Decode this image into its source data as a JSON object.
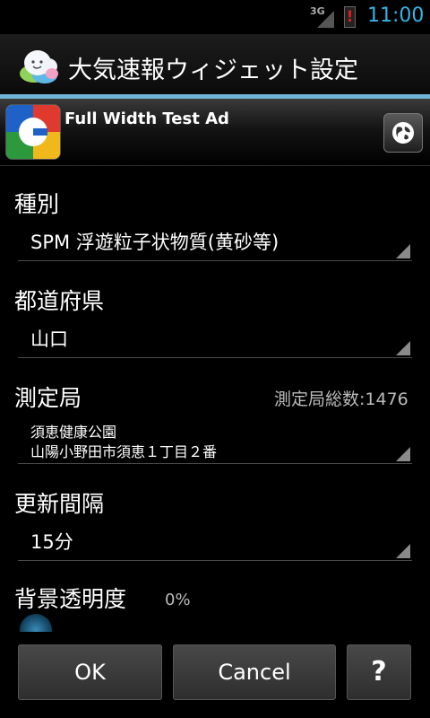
{
  "statusbar": {
    "network": "3G",
    "time": "11:00",
    "battery_warning": "!"
  },
  "header": {
    "title": "大気速報ウィジェット設定"
  },
  "ad": {
    "text": "Full Width Test Ad"
  },
  "settings": {
    "type": {
      "label": "種別",
      "value": "SPM 浮遊粒子状物質(黄砂等)"
    },
    "prefecture": {
      "label": "都道府県",
      "value": "山口"
    },
    "station": {
      "label": "測定局",
      "count_label": "測定局総数:1476",
      "name": "須恵健康公園",
      "address": "山陽小野田市須恵１丁目２番"
    },
    "interval": {
      "label": "更新間隔",
      "value": "15分"
    },
    "transparency": {
      "label": "背景透明度",
      "value_text": "0%",
      "value": 0
    }
  },
  "buttons": {
    "ok": "OK",
    "cancel": "Cancel",
    "help": "?"
  }
}
